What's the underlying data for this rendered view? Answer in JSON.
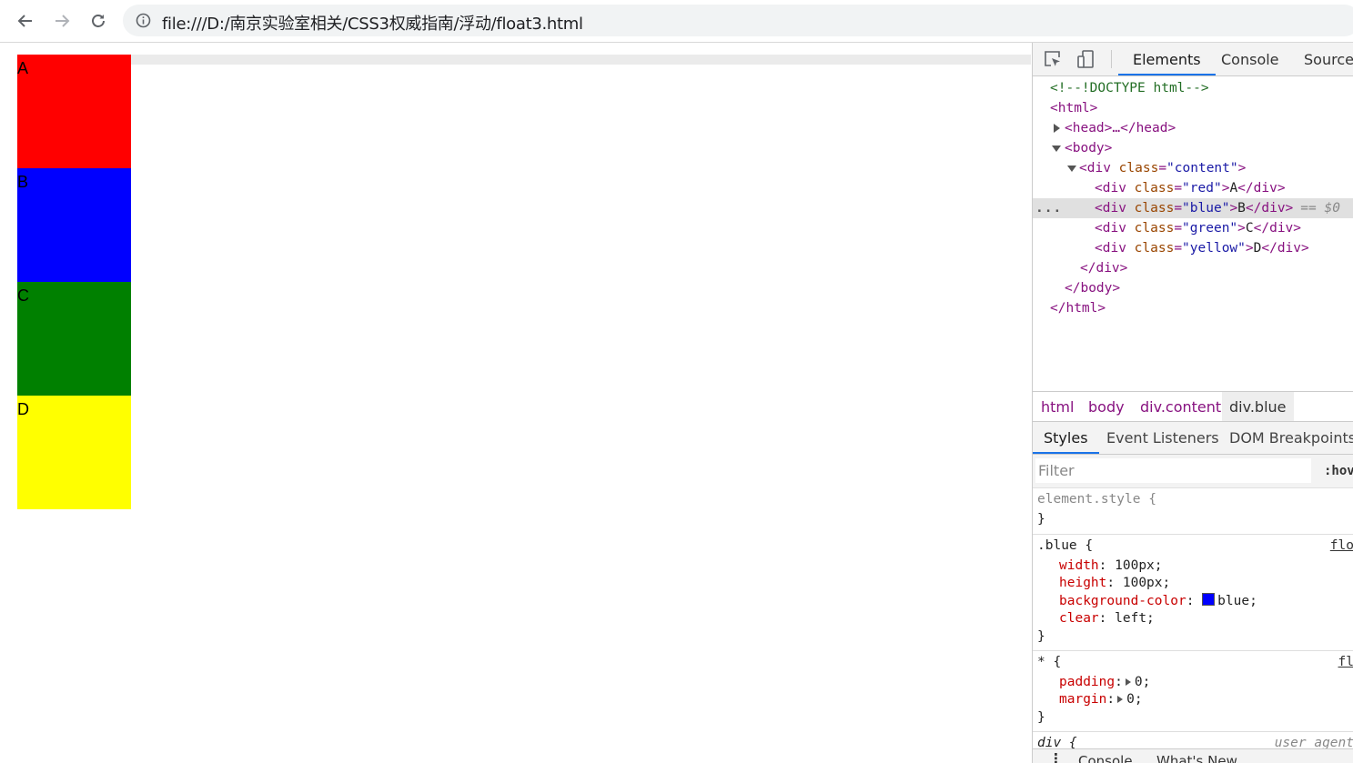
{
  "browser": {
    "url": "file:///D:/南京实验室相关/CSS3权威指南/浮动/float3.html",
    "icons": [
      "back-arrow-icon",
      "forward-arrow-icon",
      "reload-icon",
      "info-icon"
    ]
  },
  "page": {
    "boxes": [
      {
        "label": "A",
        "color": "#ff0000"
      },
      {
        "label": "B",
        "color": "#0000ff"
      },
      {
        "label": "C",
        "color": "#008000"
      },
      {
        "label": "D",
        "color": "#ffff00"
      }
    ]
  },
  "devtools": {
    "tabs": [
      "Elements",
      "Console",
      "Sources"
    ],
    "active_tab": "Elements",
    "dom": {
      "doctype": "<!--!DOCTYPE html-->",
      "html_open": "<html>",
      "head": "<head>…</head>",
      "body_open": "<body>",
      "div_open_tag": "<div ",
      "class_attr": "class",
      "content_val": "\"content\"",
      "red_val": "\"red\"",
      "blue_val": "\"blue\"",
      "green_val": "\"green\"",
      "yellow_val": "\"yellow\"",
      "gt": ">",
      "eq_sign": "=",
      "text_a": "A",
      "text_b": "B",
      "text_c": "C",
      "text_d": "D",
      "div_close": "</div>",
      "body_close": "</body>",
      "html_close": "</html>",
      "selected_marker": "== $0",
      "dots": "..."
    },
    "breadcrumbs": [
      "html",
      "body",
      "div.content",
      "div.blue"
    ],
    "styles_tabs": [
      "Styles",
      "Event Listeners",
      "DOM Breakpoints"
    ],
    "filter_placeholder": "Filter",
    "hov": ":hov",
    "rules": {
      "element_style": "element.style {",
      "close_brace": "}",
      "blue_selector": ".blue {",
      "blue_source": "flo",
      "width_prop": "width",
      "width_val": "100px;",
      "height_prop": "height",
      "height_val": "100px;",
      "bg_prop": "background-color",
      "bg_val": "blue;",
      "clear_prop": "clear",
      "clear_val": "left;",
      "star_selector": "* {",
      "star_source": "fl",
      "padding_prop": "padding",
      "padding_val": "0;",
      "margin_prop": "margin",
      "margin_val": "0;",
      "colon": ":",
      "div_selector": "div {",
      "ua_source": "user agent"
    },
    "drawer": {
      "console": "Console",
      "whats_new": "What's New"
    },
    "accent_color": "#1a73e8"
  }
}
